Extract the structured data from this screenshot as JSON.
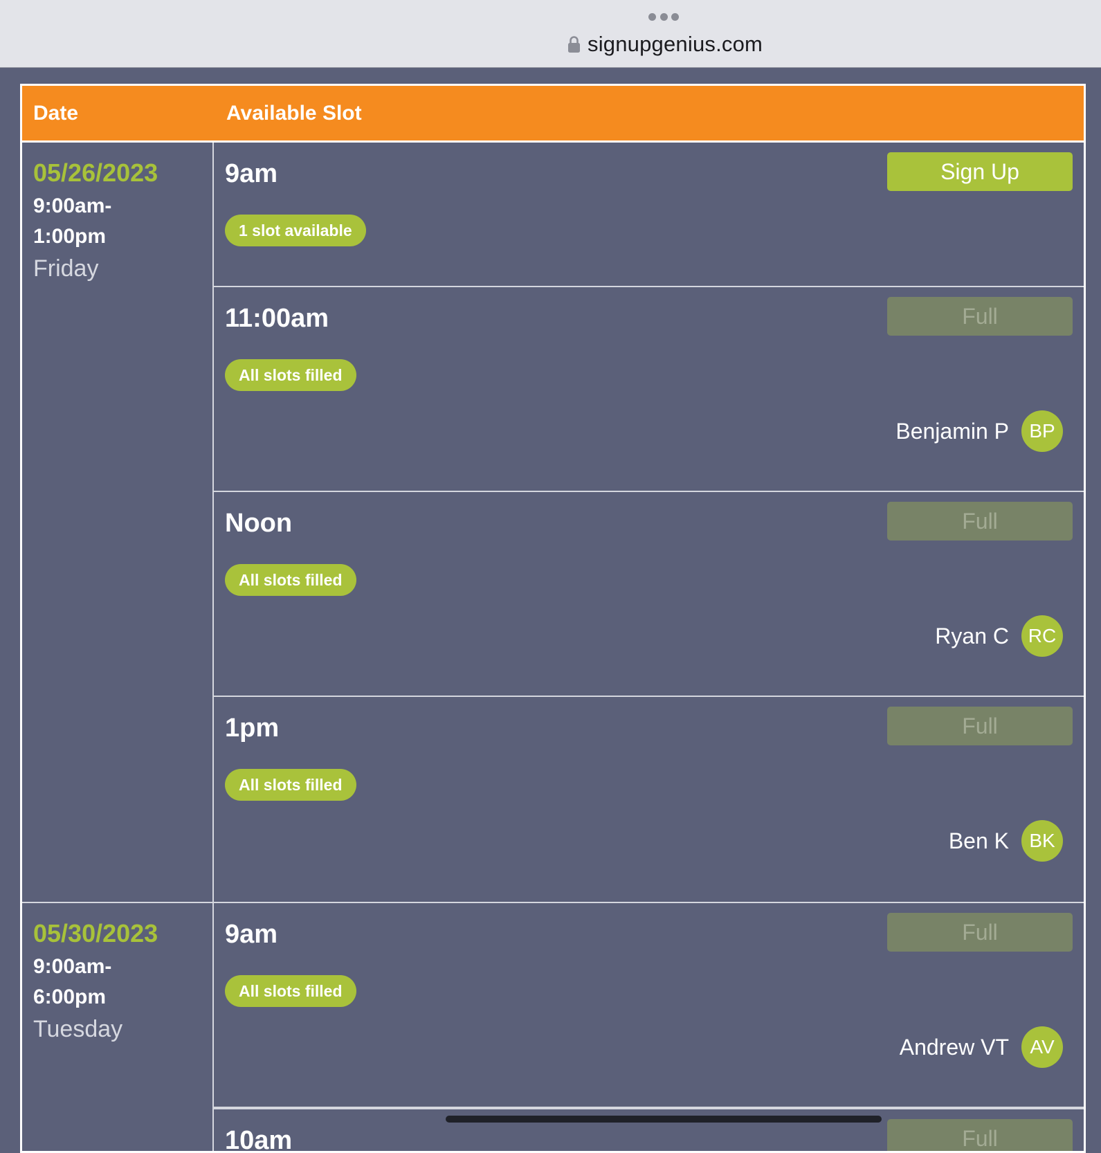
{
  "browser": {
    "url": "signupgenius.com",
    "icons": {
      "menu": "more-dots-icon",
      "lock": "lock-icon"
    }
  },
  "table": {
    "headers": {
      "date": "Date",
      "slot": "Available Slot"
    },
    "groups": [
      {
        "date": "05/26/2023",
        "time_line1": "9:00am-",
        "time_line2": "1:00pm",
        "day": "Friday",
        "slots": [
          {
            "time": "9am",
            "status": "1 slot available",
            "button": "Sign Up",
            "participant": null,
            "initials": null
          },
          {
            "time": "11:00am",
            "status": "All slots filled",
            "button": "Full",
            "participant": "Benjamin P",
            "initials": "BP"
          },
          {
            "time": "Noon",
            "status": "All slots filled",
            "button": "Full",
            "participant": "Ryan C",
            "initials": "RC"
          },
          {
            "time": "1pm",
            "status": "All slots filled",
            "button": "Full",
            "participant": "Ben K",
            "initials": "BK"
          }
        ]
      },
      {
        "date": "05/30/2023",
        "time_line1": "9:00am-",
        "time_line2": "6:00pm",
        "day": "Tuesday",
        "slots": [
          {
            "time": "9am",
            "status": "All slots filled",
            "button": "Full",
            "participant": "Andrew VT",
            "initials": "AV"
          },
          {
            "time": "10am",
            "status": "",
            "button": "Full",
            "participant": null,
            "initials": null
          }
        ]
      }
    ]
  },
  "colors": {
    "header_orange": "#f58b1f",
    "accent_green": "#a9c23b",
    "full_button": "#788367",
    "background": "#5b6079"
  }
}
